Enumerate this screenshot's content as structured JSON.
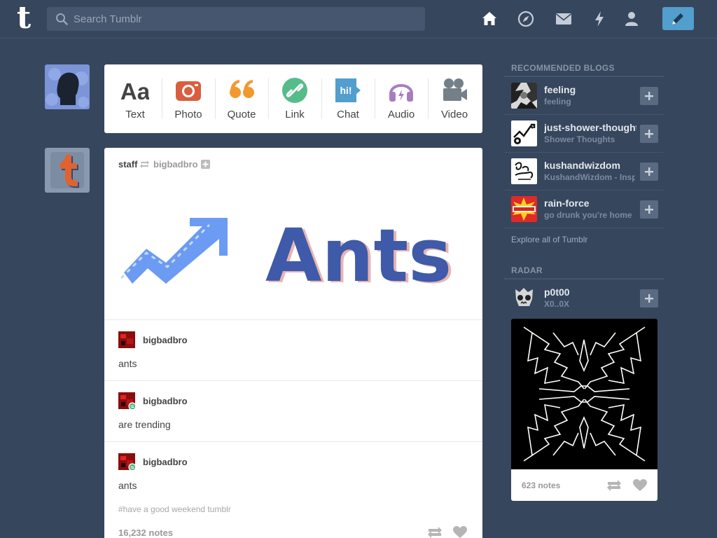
{
  "header": {
    "logo": "t",
    "search_placeholder": "Search Tumblr",
    "nav_icons": [
      "home-icon",
      "explore-icon",
      "inbox-icon",
      "activity-icon",
      "account-icon"
    ],
    "compose_icon": "pencil-icon"
  },
  "post_types": [
    {
      "label": "Text",
      "icon": "text-icon",
      "color": "#444444"
    },
    {
      "label": "Photo",
      "icon": "camera-icon",
      "color": "#d95e40"
    },
    {
      "label": "Quote",
      "icon": "quote-icon",
      "color": "#f2992e"
    },
    {
      "label": "Link",
      "icon": "link-icon",
      "color": "#56bc8a"
    },
    {
      "label": "Chat",
      "icon": "chat-icon",
      "color": "#529ecc"
    },
    {
      "label": "Audio",
      "icon": "headphones-icon",
      "color": "#a77dc2"
    },
    {
      "label": "Video",
      "icon": "video-camera-icon",
      "color": "#748089"
    }
  ],
  "post": {
    "author": "staff",
    "reblogged_from": "bigbadbro",
    "image_text": "Ants",
    "thread": [
      {
        "user": "bigbadbro",
        "text": "ants"
      },
      {
        "user": "bigbadbro",
        "text": "are trending"
      },
      {
        "user": "bigbadbro",
        "text": "ants"
      }
    ],
    "tags": "#have a good weekend tumblr",
    "notes": "16,232 notes"
  },
  "sidebar": {
    "recommended_title": "RECOMMENDED BLOGS",
    "blogs": [
      {
        "name": "feeling",
        "desc": "feeling"
      },
      {
        "name": "just-shower-thoughts",
        "desc": "Shower Thoughts"
      },
      {
        "name": "kushandwizdom",
        "desc": "KushandWizdom - Inspiration"
      },
      {
        "name": "rain-force",
        "desc": "go drunk you're home"
      }
    ],
    "explore": "Explore all of Tumblr",
    "radar_title": "RADAR",
    "radar": {
      "name": "p0t00",
      "desc": "X0..0X",
      "notes": "623 notes"
    }
  },
  "colors": {
    "background": "#36465d",
    "accent": "#529ecc"
  }
}
